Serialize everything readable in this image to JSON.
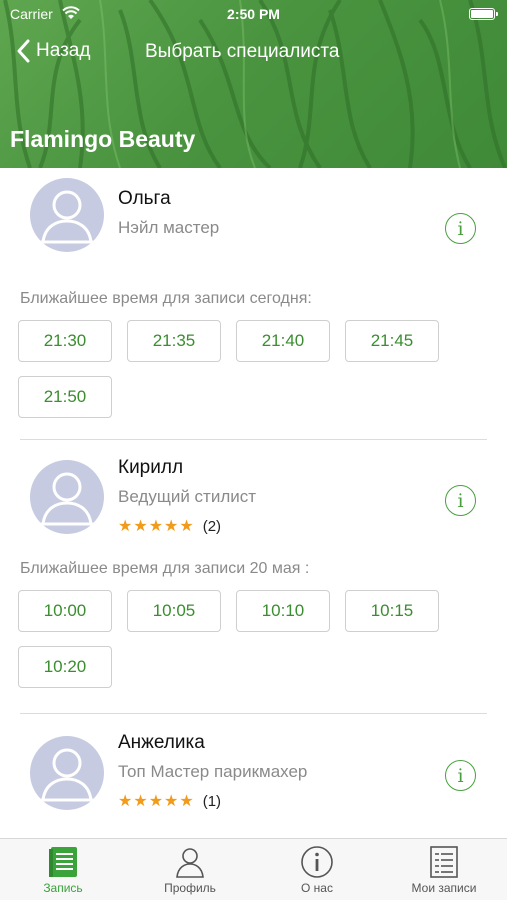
{
  "status_bar": {
    "carrier": "Carrier",
    "time": "2:50 PM"
  },
  "nav": {
    "back_label": "Назад",
    "title": "Выбрать специалиста"
  },
  "brand": "Flamingo Beauty",
  "colors": {
    "accent": "#4aa040",
    "header": "#4a9440",
    "star": "#f29b1a"
  },
  "specialists": [
    {
      "name": "Ольга",
      "role": "Нэйл мастер",
      "slots_label": "Ближайшее время для записи сегодня:",
      "slots": [
        "21:30",
        "21:35",
        "21:40",
        "21:45",
        "21:50"
      ]
    },
    {
      "name": "Кирилл",
      "role": "Ведущий стилист",
      "stars": "★★★★★",
      "rating_count": "(2)",
      "slots_label": "Ближайшее время для записи 20 мая :",
      "slots": [
        "10:00",
        "10:05",
        "10:10",
        "10:15",
        "10:20"
      ]
    },
    {
      "name": "Анжелика",
      "role": "Топ Мастер парикмахер",
      "stars": "★★★★★",
      "rating_count": "(1)"
    }
  ],
  "tabs": [
    {
      "label": "Запись",
      "icon": "booking-icon",
      "active": true
    },
    {
      "label": "Профиль",
      "icon": "profile-icon"
    },
    {
      "label": "О нас",
      "icon": "info-icon"
    },
    {
      "label": "Мои записи",
      "icon": "list-icon"
    }
  ]
}
